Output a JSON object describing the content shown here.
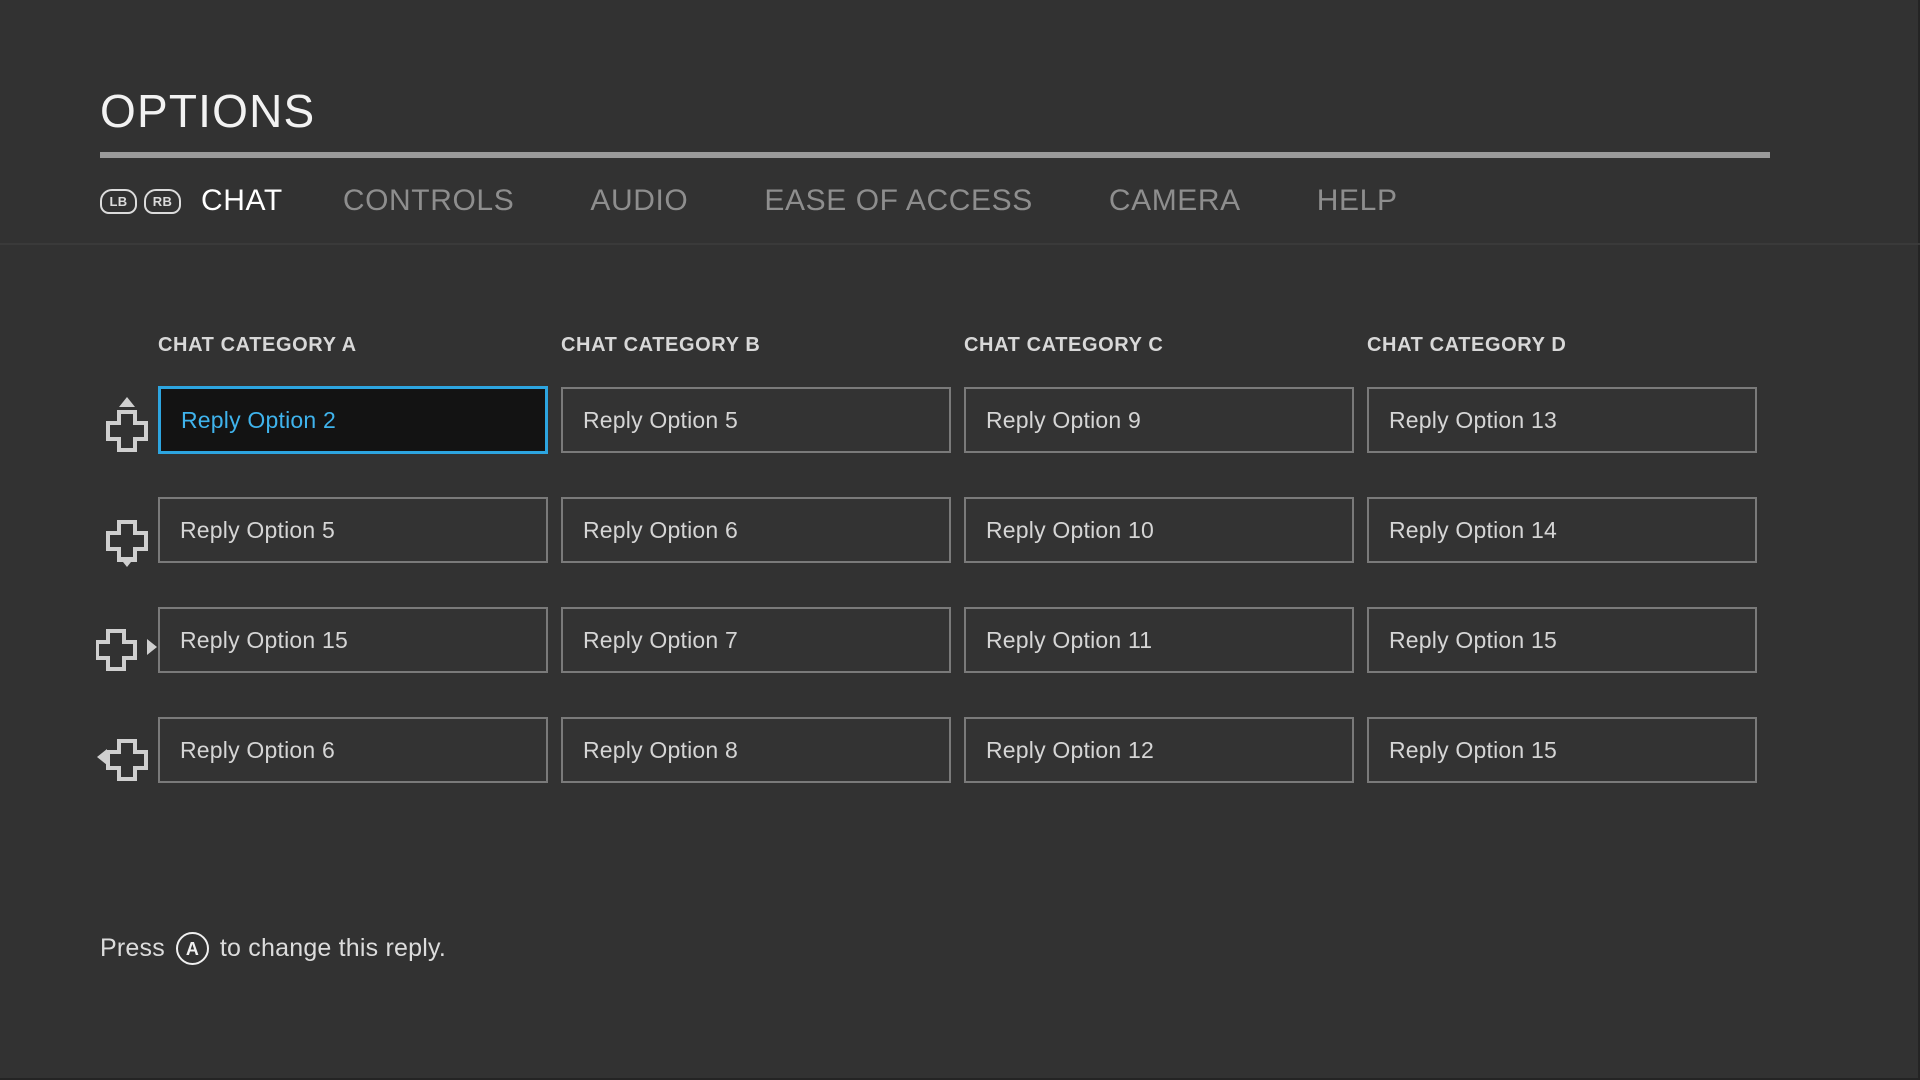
{
  "header": {
    "title": "OPTIONS",
    "bumpers": [
      {
        "name": "lb-bumper",
        "label": "LB"
      },
      {
        "name": "rb-bumper",
        "label": "RB"
      }
    ],
    "tabs": [
      {
        "label": "CHAT",
        "active": true
      },
      {
        "label": "CONTROLS",
        "active": false
      },
      {
        "label": "AUDIO",
        "active": false
      },
      {
        "label": "EASE OF ACCESS",
        "active": false
      },
      {
        "label": "CAMERA",
        "active": false
      },
      {
        "label": "HELP",
        "active": false
      }
    ]
  },
  "grid": {
    "columns": [
      {
        "header": "CHAT CATEGORY A"
      },
      {
        "header": "CHAT CATEGORY B"
      },
      {
        "header": "CHAT CATEGORY C"
      },
      {
        "header": "CHAT CATEGORY D"
      }
    ],
    "dpad_icons": [
      "dpad-up-icon",
      "dpad-down-icon",
      "dpad-right-icon",
      "dpad-left-icon"
    ],
    "rows": [
      {
        "dpad": "dpad-up-icon",
        "cells": [
          {
            "label": "Reply Option 2",
            "selected": true
          },
          {
            "label": "Reply Option 5",
            "selected": false
          },
          {
            "label": "Reply Option 9",
            "selected": false
          },
          {
            "label": "Reply Option 13",
            "selected": false
          }
        ]
      },
      {
        "dpad": "dpad-down-icon",
        "cells": [
          {
            "label": "Reply Option 5",
            "selected": false
          },
          {
            "label": "Reply Option 6",
            "selected": false
          },
          {
            "label": "Reply Option 10",
            "selected": false
          },
          {
            "label": "Reply Option 14",
            "selected": false
          }
        ]
      },
      {
        "dpad": "dpad-right-icon",
        "cells": [
          {
            "label": "Reply Option 15",
            "selected": false
          },
          {
            "label": "Reply Option 7",
            "selected": false
          },
          {
            "label": "Reply Option 11",
            "selected": false
          },
          {
            "label": "Reply Option 15",
            "selected": false
          }
        ]
      },
      {
        "dpad": "dpad-left-icon",
        "cells": [
          {
            "label": "Reply Option 6",
            "selected": false
          },
          {
            "label": "Reply Option 8",
            "selected": false
          },
          {
            "label": "Reply Option 12",
            "selected": false
          },
          {
            "label": "Reply Option 15",
            "selected": false
          }
        ]
      }
    ]
  },
  "footer": {
    "prefix": "Press",
    "button": "A",
    "suffix": "to change this reply."
  },
  "colors": {
    "background": "#323232",
    "accent": "#2da5e0",
    "accent_text": "#3fb3ec",
    "text_primary": "#f2f2f2",
    "text_secondary": "#d5d5d5",
    "text_muted": "#8e8e8e",
    "cell_border": "#7a7a7a",
    "cell_fill": "#333333",
    "selected_fill": "#131313",
    "rule": "#9a9a9a"
  }
}
